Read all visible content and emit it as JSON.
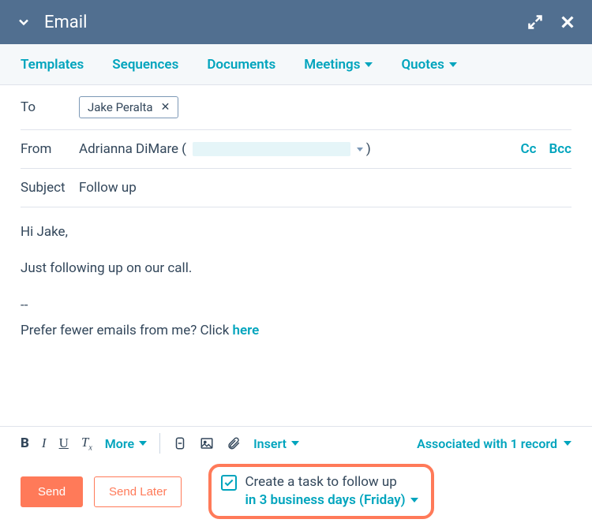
{
  "header": {
    "title": "Email"
  },
  "toolbar": {
    "templates": "Templates",
    "sequences": "Sequences",
    "documents": "Documents",
    "meetings": "Meetings",
    "quotes": "Quotes"
  },
  "fields": {
    "to_label": "To",
    "to_chip": "Jake Peralta",
    "from_label": "From",
    "from_name": "Adrianna DiMare",
    "cc": "Cc",
    "bcc": "Bcc",
    "subject_label": "Subject",
    "subject_value": "Follow up"
  },
  "body": {
    "line1": "Hi Jake,",
    "line2": "Just following up on our call.",
    "sig_sep": "--",
    "sig_text": "Prefer fewer emails from me? Click ",
    "sig_link": "here"
  },
  "format": {
    "more": "More",
    "insert": "Insert",
    "associated": "Associated with 1 record"
  },
  "actions": {
    "send": "Send",
    "send_later": "Send Later"
  },
  "followup": {
    "text": "Create a task to follow up",
    "schedule": "in 3 business days (Friday)"
  }
}
